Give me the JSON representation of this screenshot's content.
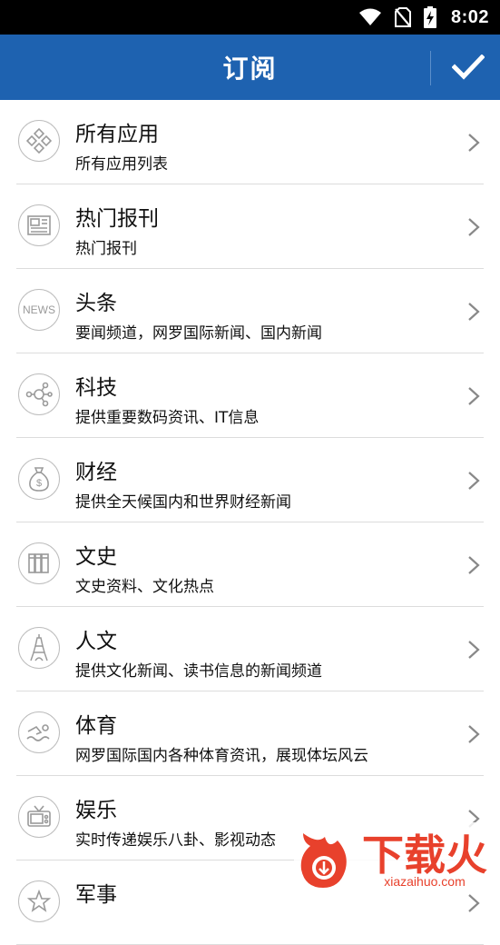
{
  "status_bar": {
    "time": "8:02",
    "icons": [
      "wifi-icon",
      "no-sim-icon",
      "battery-charging-icon"
    ]
  },
  "app_bar": {
    "title": "订阅",
    "confirm_icon": "check-icon"
  },
  "subscriptions": [
    {
      "title": "所有应用",
      "desc": "所有应用列表",
      "icon": "apps-icon"
    },
    {
      "title": "热门报刊",
      "desc": "热门报刊",
      "icon": "newspaper-icon"
    },
    {
      "title": "头条",
      "desc": "要闻频道，网罗国际新闻、国内新闻",
      "icon": "news-icon",
      "icon_text": "NEWS"
    },
    {
      "title": "科技",
      "desc": "提供重要数码资讯、IT信息",
      "icon": "network-icon"
    },
    {
      "title": "财经",
      "desc": "提供全天候国内和世界财经新闻",
      "icon": "money-bag-icon"
    },
    {
      "title": "文史",
      "desc": "文史资料、文化热点",
      "icon": "books-icon"
    },
    {
      "title": "人文",
      "desc": "提供文化新闻、读书信息的新闻频道",
      "icon": "tower-icon"
    },
    {
      "title": "体育",
      "desc": "网罗国际国内各种体育资讯，展现体坛风云",
      "icon": "swimmer-icon"
    },
    {
      "title": "娱乐",
      "desc": "实时传递娱乐八卦、影视动态",
      "icon": "tv-icon"
    },
    {
      "title": "军事",
      "desc": "",
      "icon": "military-icon"
    }
  ],
  "watermark": {
    "text": "下载火",
    "url": "xiazaihuo.com",
    "color": "#e8412c"
  }
}
